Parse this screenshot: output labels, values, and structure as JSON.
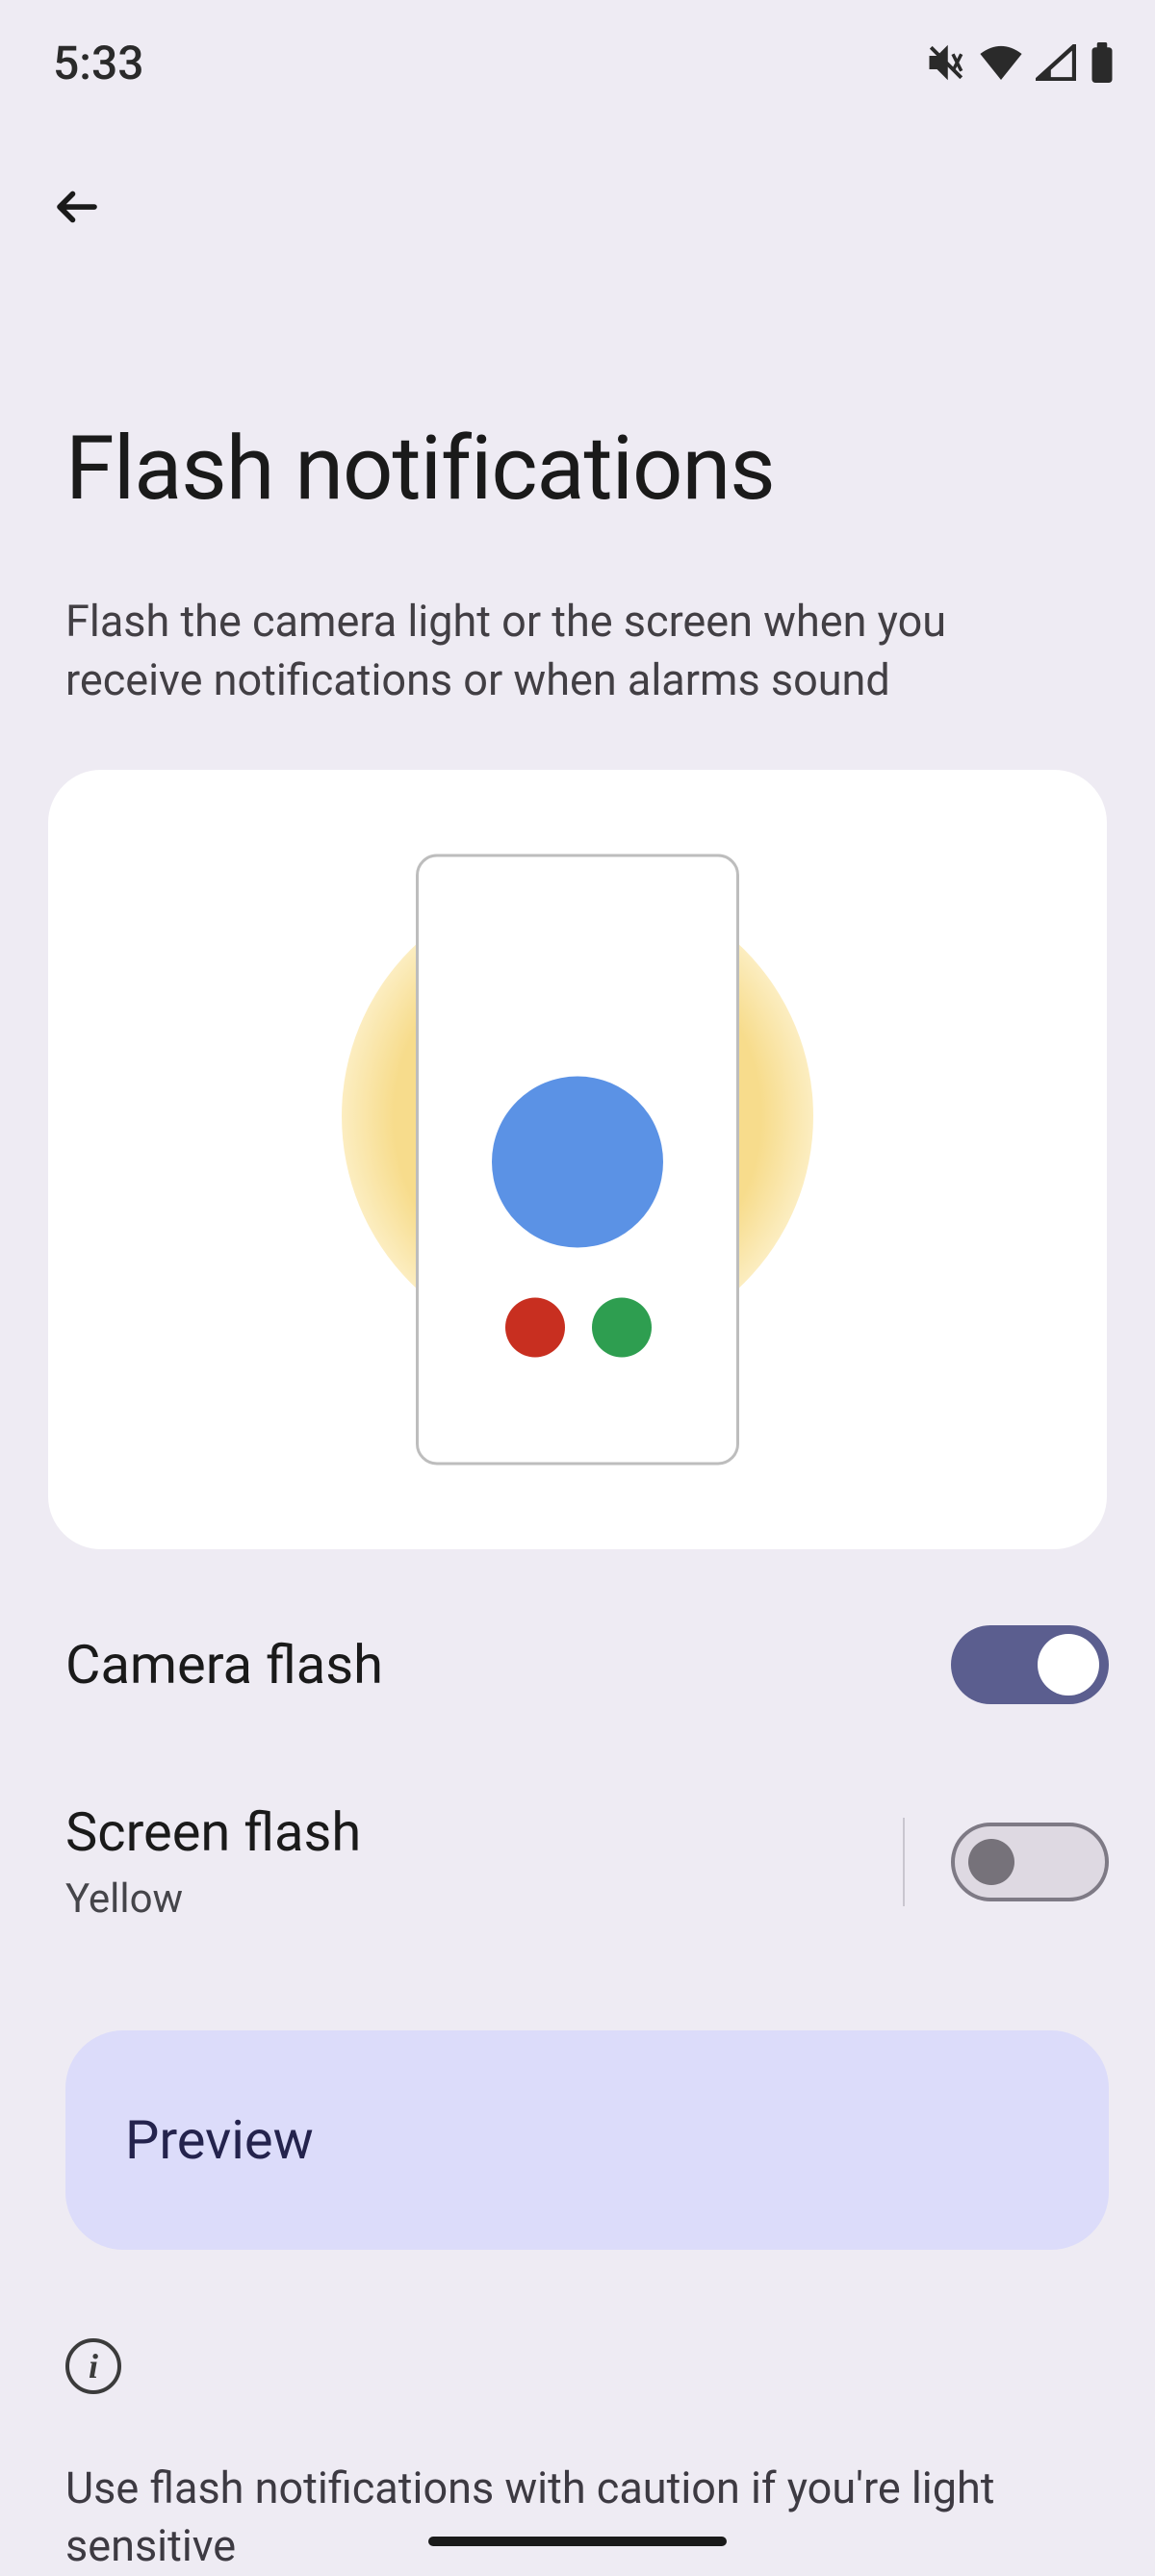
{
  "status": {
    "time": "5:33"
  },
  "page": {
    "title": "Flash notifications",
    "description": "Flash the camera light or the screen when you receive notifications or when alarms sound"
  },
  "settings": {
    "camera_flash": {
      "label": "Camera flash",
      "enabled": true
    },
    "screen_flash": {
      "label": "Screen flash",
      "color": "Yellow",
      "enabled": false
    }
  },
  "preview": {
    "label": "Preview"
  },
  "info": {
    "text": "Use flash notifications with caution if you're light sensitive"
  }
}
